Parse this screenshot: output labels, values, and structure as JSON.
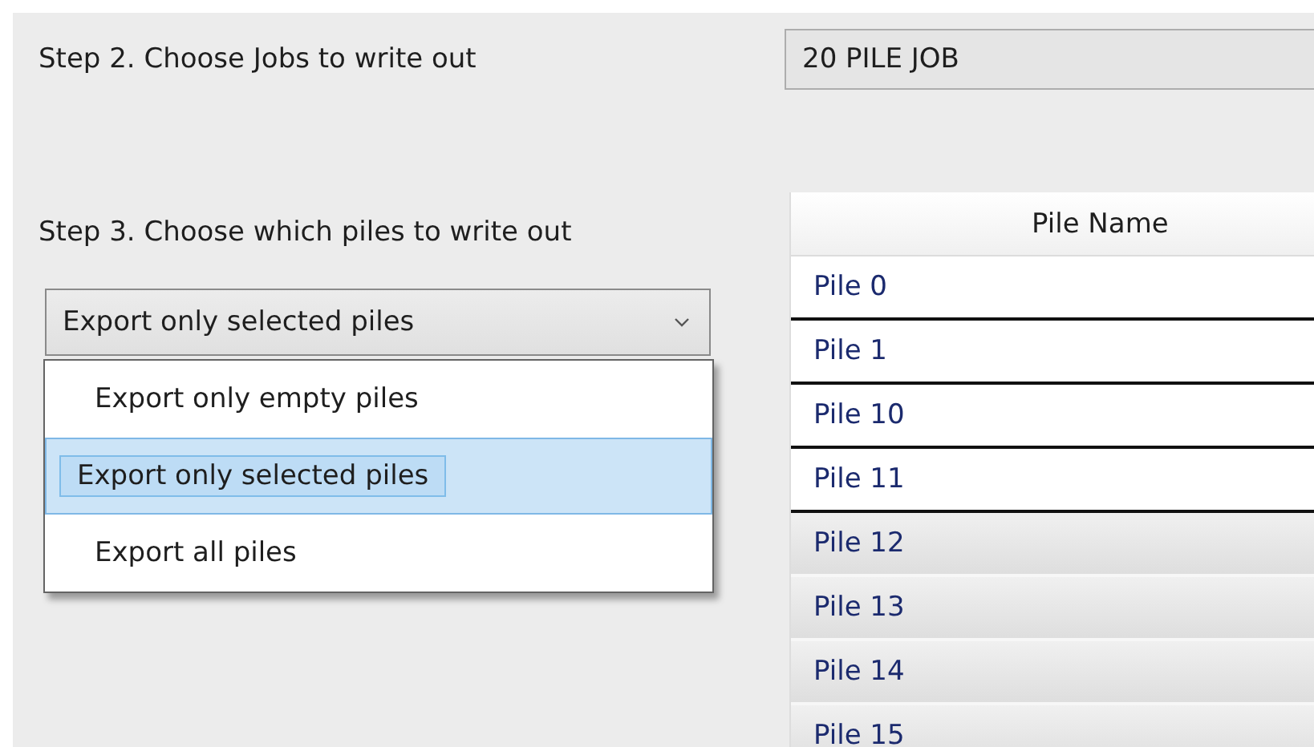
{
  "step2": {
    "label": "Step 2. Choose Jobs to write out",
    "job_field": {
      "value": "20 PILE JOB"
    }
  },
  "step3": {
    "label": "Step 3. Choose which piles to write out",
    "combo": {
      "value": "Export only selected piles",
      "expanded": true,
      "options": [
        {
          "label": "Export only empty piles",
          "selected": false
        },
        {
          "label": "Export only selected piles",
          "selected": true
        },
        {
          "label": "Export all piles",
          "selected": false
        }
      ]
    }
  },
  "table": {
    "columns": [
      "Pile Name"
    ],
    "rows": [
      {
        "name": "Pile 0",
        "selected": true
      },
      {
        "name": "Pile 1",
        "selected": true
      },
      {
        "name": "Pile 10",
        "selected": true
      },
      {
        "name": "Pile 11",
        "selected": true
      },
      {
        "name": "Pile 12",
        "selected": false
      },
      {
        "name": "Pile 13",
        "selected": false
      },
      {
        "name": "Pile 14",
        "selected": false
      },
      {
        "name": "Pile 15",
        "selected": false
      }
    ]
  }
}
